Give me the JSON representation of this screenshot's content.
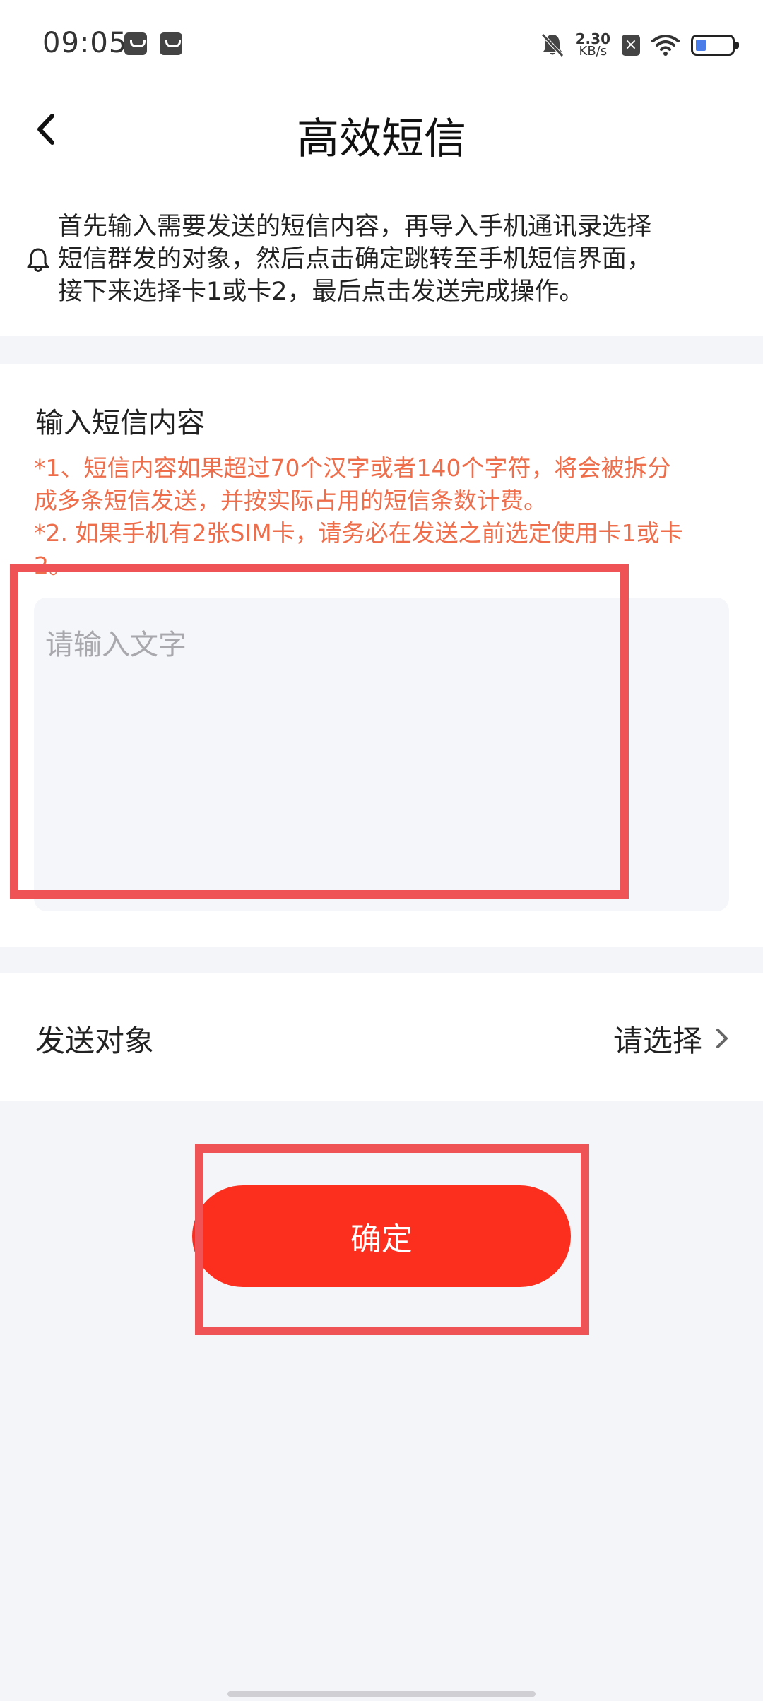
{
  "status_bar": {
    "time": "09:05",
    "net_speed_value": "2.30",
    "net_speed_unit": "KB/s",
    "sim_status": "×",
    "icons": [
      "notification-icon",
      "message-icon",
      "bell-off-icon",
      "wifi-icon",
      "battery-icon"
    ]
  },
  "nav": {
    "title": "高效短信",
    "back_icon": "chevron-left-icon"
  },
  "notice": {
    "icon": "bell-icon",
    "text": "首先输入需要发送的短信内容，再导入手机通讯录选择\n短信群发的对象，然后点击确定跳转至手机短信界面，\n接下来选择卡1或卡2，最后点击发送完成操作。"
  },
  "content": {
    "heading": "输入短信内容",
    "warnings": "*1、短信内容如果超过70个汉字或者140个字符，将会被拆分\n成多条短信发送，并按实际占用的短信条数计费。\n*2. 如果手机有2张SIM卡，请务必在发送之前选定使用卡1或卡\n2。",
    "input_placeholder": "请输入文字",
    "input_value": ""
  },
  "recipient": {
    "label": "发送对象",
    "value": "请选择",
    "icon": "chevron-right-icon"
  },
  "confirm_button": {
    "label": "确定"
  },
  "colors": {
    "accent": "#fc2f1e",
    "warning_text": "#ee6d4a",
    "highlight_box": "#ef5355",
    "page_bg": "#f4f5f9"
  }
}
